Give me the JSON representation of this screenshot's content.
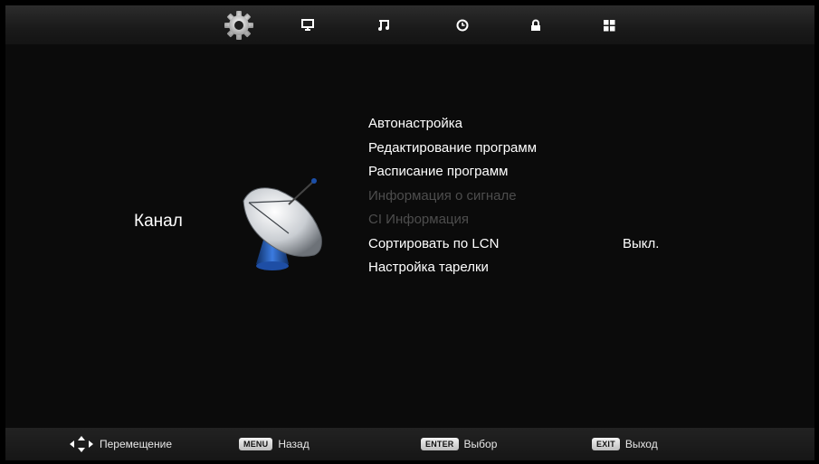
{
  "top_tabs": [
    {
      "name": "channel",
      "icon": "gear-icon",
      "selected": true
    },
    {
      "name": "picture",
      "icon": "monitor-icon",
      "selected": false
    },
    {
      "name": "sound",
      "icon": "music-note-icon",
      "selected": false
    },
    {
      "name": "time",
      "icon": "clock-icon",
      "selected": false
    },
    {
      "name": "lock",
      "icon": "lock-icon",
      "selected": false
    },
    {
      "name": "setup",
      "icon": "grid-icon",
      "selected": false
    }
  ],
  "category": {
    "label": "Канал",
    "icon": "satellite-dish-icon"
  },
  "menu_items": [
    {
      "label": "Автонастройка",
      "enabled": true
    },
    {
      "label": "Редактирование программ",
      "enabled": true
    },
    {
      "label": "Расписание программ",
      "enabled": true
    },
    {
      "label": "Информация о сигнале",
      "enabled": false
    },
    {
      "label": "CI Информация",
      "enabled": false
    },
    {
      "label": "Сортировать по LCN",
      "enabled": true,
      "value": "Выкл."
    },
    {
      "label": "Настройка тарелки",
      "enabled": true
    }
  ],
  "footer": {
    "move": {
      "icon": "arrows-icon",
      "label": "Перемещение"
    },
    "back": {
      "key": "MENU",
      "label": "Назад"
    },
    "select": {
      "key": "ENTER",
      "label": "Выбор"
    },
    "exit": {
      "key": "EXIT",
      "label": "Выход"
    }
  },
  "colors": {
    "background": "#0b0b0b",
    "text": "#ffffff",
    "disabled_text": "#4d4d4d"
  }
}
